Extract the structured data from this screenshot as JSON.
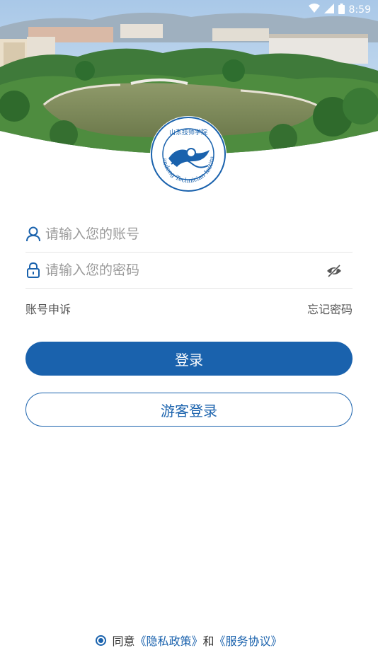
{
  "status_bar": {
    "time": "8:59"
  },
  "logo": {
    "circle_text": "Shandong Technician Institute",
    "top_text": "山东技师学院"
  },
  "login": {
    "account_placeholder": "请输入您的账号",
    "password_placeholder": "请输入您的密码",
    "account_appeal": "账号申诉",
    "forgot_password": "忘记密码",
    "login_button": "登录",
    "guest_login_button": "游客登录"
  },
  "agreement": {
    "prefix": "同意",
    "privacy_link": "《隐私政策》",
    "and": "和",
    "service_link": "《服务协议》"
  },
  "colors": {
    "primary": "#1a62ad",
    "text": "#333333",
    "placeholder": "#9a9a9a"
  }
}
